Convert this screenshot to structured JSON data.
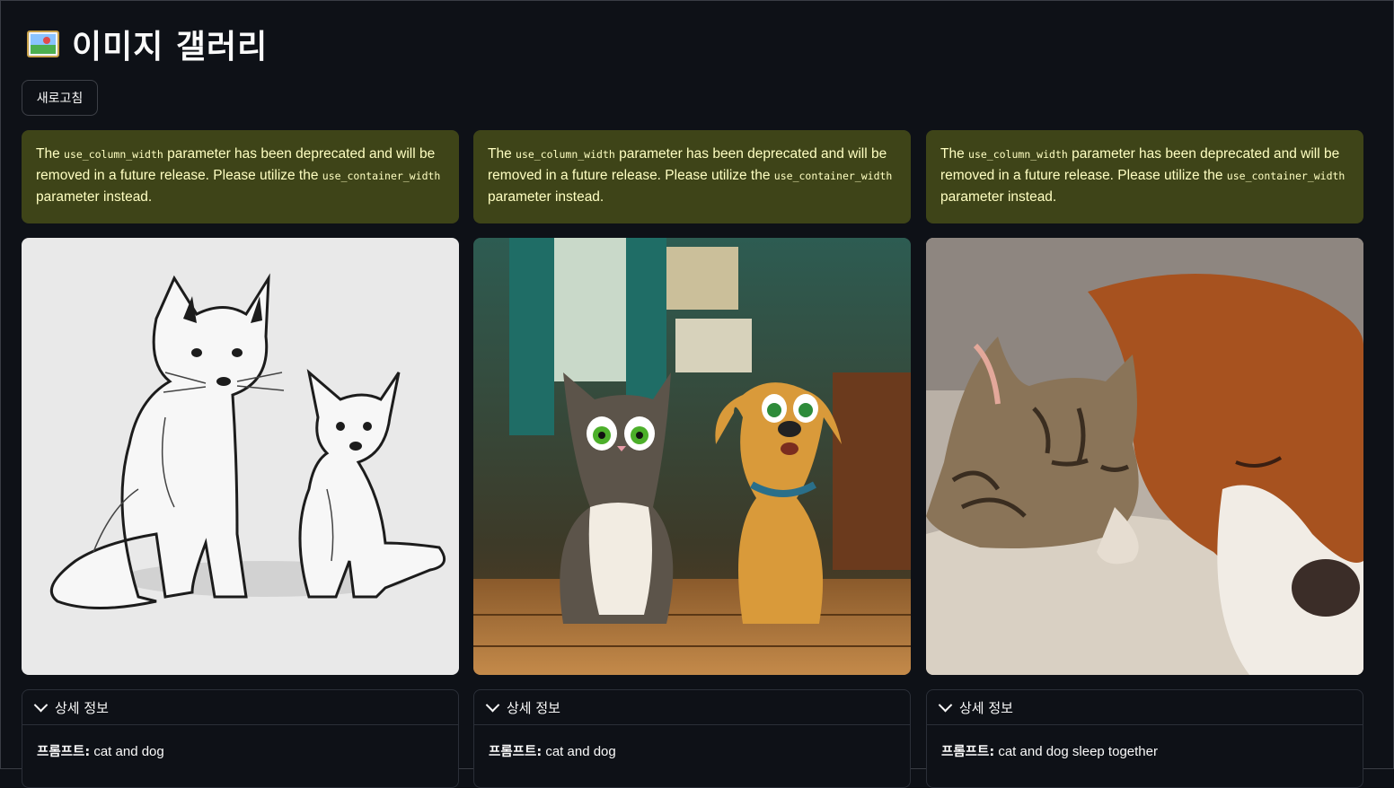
{
  "page": {
    "title": "이미지 갤러리",
    "title_icon": "framed-picture-icon"
  },
  "toolbar": {
    "refresh_label": "새로고침"
  },
  "warning": {
    "prefix": "The ",
    "param_old": "use_column_width",
    "middle": " parameter has been deprecated and will be removed in a future release. Please utilize the ",
    "param_new": "use_container_width",
    "suffix": " parameter instead."
  },
  "gallery": [
    {
      "image": "sketch-cat-and-dog",
      "expander_label": "상세 정보",
      "prompt_label": "프롬프트:",
      "prompt": " cat and dog"
    },
    {
      "image": "cartoon-cat-and-dog-room",
      "expander_label": "상세 정보",
      "prompt_label": "프롬프트:",
      "prompt": " cat and dog"
    },
    {
      "image": "photo-cat-and-dog-sleeping",
      "expander_label": "상세 정보",
      "prompt_label": "프롬프트:",
      "prompt": " cat and dog sleep together"
    }
  ],
  "colors": {
    "background": "#0e1117",
    "warning_bg": "#3e4418",
    "warning_text": "#ffffc2"
  }
}
